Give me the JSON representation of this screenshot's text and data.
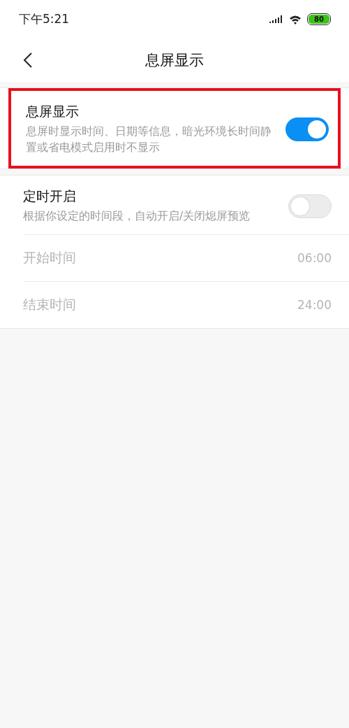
{
  "status_bar": {
    "time": "下午5:21",
    "battery": "80"
  },
  "header": {
    "title": "息屏显示"
  },
  "sections": [
    {
      "items": [
        {
          "kind": "toggle",
          "title": "息屏显示",
          "description": "息屏时显示时间、日期等信息，暗光环境长时间静置或省电模式启用时不显示",
          "on": true,
          "highlighted": true
        }
      ]
    },
    {
      "items": [
        {
          "kind": "toggle",
          "title": "定时开启",
          "description": "根据你设定的时间段，自动开启/关闭熄屏预览",
          "on": false
        },
        {
          "kind": "value",
          "title": "开始时间",
          "value": "06:00",
          "disabled": true
        },
        {
          "kind": "value",
          "title": "结束时间",
          "value": "24:00",
          "disabled": true
        }
      ]
    }
  ]
}
